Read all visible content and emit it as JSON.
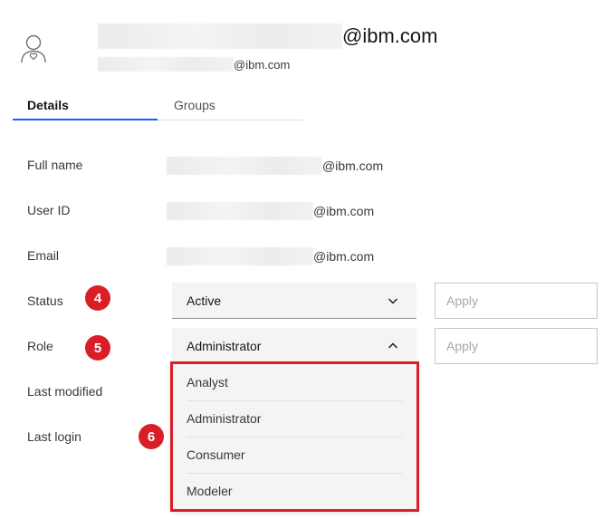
{
  "header": {
    "title_suffix": "@ibm.com",
    "subtitle_suffix": "@ibm.com",
    "avatar_icon": "user-avatar-icon"
  },
  "tabs": [
    {
      "label": "Details",
      "active": true
    },
    {
      "label": "Groups",
      "active": false
    }
  ],
  "fields": {
    "full_name": {
      "label": "Full name",
      "value_suffix": "@ibm.com"
    },
    "user_id": {
      "label": "User ID",
      "value_suffix": "@ibm.com"
    },
    "email": {
      "label": "Email",
      "value_suffix": "@ibm.com"
    },
    "status": {
      "label": "Status",
      "selected": "Active",
      "apply_placeholder": "Apply",
      "expanded": false
    },
    "role": {
      "label": "Role",
      "selected": "Administrator",
      "apply_placeholder": "Apply",
      "expanded": true
    },
    "last_modified": {
      "label": "Last modified"
    },
    "last_login": {
      "label": "Last login"
    }
  },
  "role_options": [
    "Analyst",
    "Administrator",
    "Consumer",
    "Modeler"
  ],
  "annotations": {
    "status_badge": "4",
    "role_badge": "5",
    "menu_badge": "6"
  },
  "colors": {
    "accent": "#0f62fe",
    "badge": "#da1e28",
    "field_bg": "#f4f4f4",
    "text": "#161616"
  }
}
